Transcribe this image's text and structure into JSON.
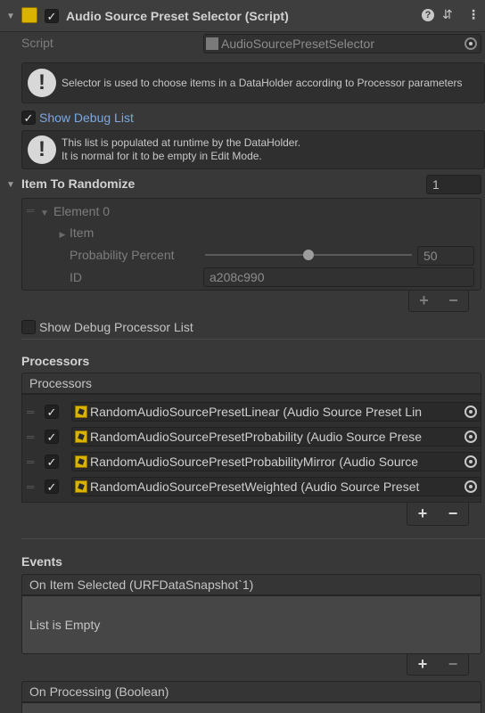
{
  "header": {
    "title": "Audio Source Preset Selector (Script)",
    "enabled": true,
    "help_icon": "help-icon",
    "settings_icon": "preset-settings-icon",
    "menu_icon": "kebab-menu-icon"
  },
  "script_row": {
    "label": "Script",
    "value": "AudioSourcePresetSelector"
  },
  "help_box_1": {
    "text": "Selector is used to choose items in a DataHolder according to Processor parameters"
  },
  "show_debug_list": {
    "label": "Show Debug List",
    "checked": true
  },
  "help_box_2": {
    "line1": "This list is populated at runtime by the DataHolder.",
    "line2": "It is normal for it to be empty in Edit Mode."
  },
  "item_to_randomize": {
    "label": "Item To Randomize",
    "count": "1",
    "element": {
      "label": "Element 0",
      "item_label": "Item",
      "probability_label": "Probability Percent",
      "probability_value": "50",
      "probability_fraction": 0.5,
      "id_label": "ID",
      "id_value": "a208c990"
    }
  },
  "show_debug_processor_list": {
    "label": "Show Debug Processor List",
    "checked": false
  },
  "processors": {
    "section_label": "Processors",
    "list_header": "Processors",
    "items": [
      {
        "checked": true,
        "label": "RandomAudioSourcePresetLinear (Audio Source Preset Lin"
      },
      {
        "checked": true,
        "label": "RandomAudioSourcePresetProbability (Audio Source Prese"
      },
      {
        "checked": true,
        "label": "RandomAudioSourcePresetProbabilityMirror (Audio Source"
      },
      {
        "checked": true,
        "label": "RandomAudioSourcePresetWeighted (Audio Source Preset"
      }
    ]
  },
  "events": {
    "section_label": "Events",
    "on_item_selected": {
      "header": "On Item Selected (URFDataSnapshot`1)",
      "empty_text": "List is Empty"
    },
    "on_processing": {
      "header": "On Processing (Boolean)"
    }
  },
  "buttons": {
    "plus": "+",
    "minus": "−",
    "check": "✓"
  }
}
